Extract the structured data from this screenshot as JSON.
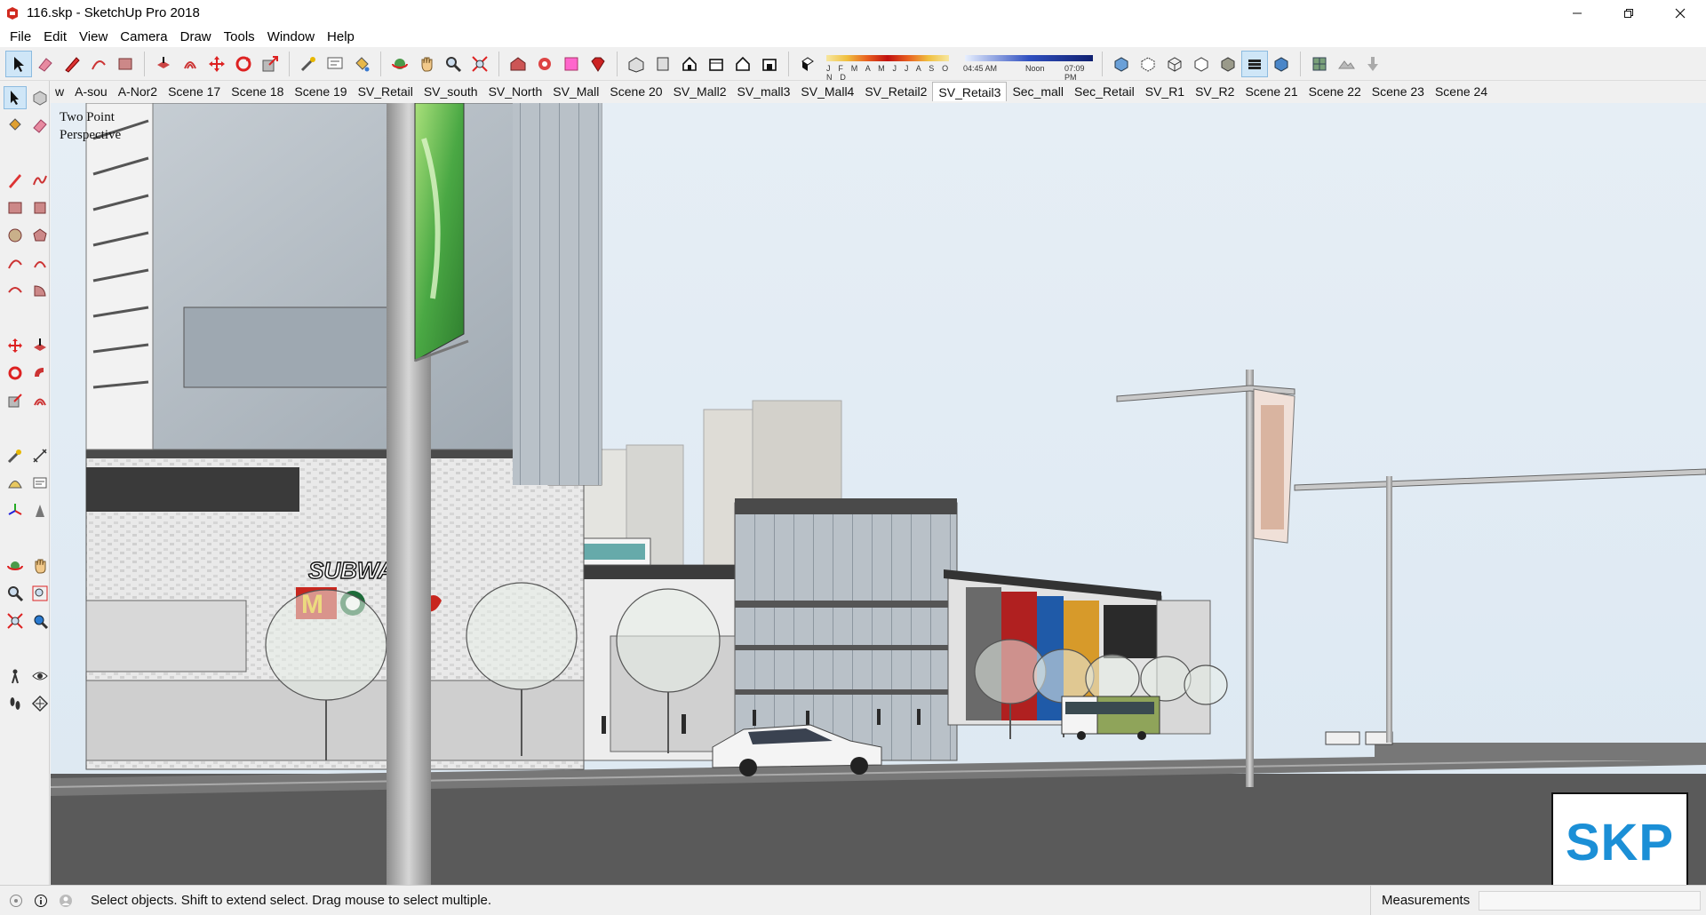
{
  "window": {
    "title": "116.skp - SketchUp Pro 2018",
    "controls": [
      "minimize",
      "restore",
      "close"
    ]
  },
  "menu": [
    "File",
    "Edit",
    "View",
    "Camera",
    "Draw",
    "Tools",
    "Window",
    "Help"
  ],
  "toolbar": {
    "months_label": "J F M A M J J A S O N D",
    "time_start": "04:45 AM",
    "time_mid": "Noon",
    "time_end": "07:09 PM"
  },
  "scenes": {
    "tabs": [
      "w",
      "A-sou",
      "A-Nor2",
      "Scene 17",
      "Scene 18",
      "Scene 19",
      "SV_Retail",
      "SV_south",
      "SV_North",
      "SV_Mall",
      "Scene 20",
      "SV_Mall2",
      "SV_mall3",
      "SV_Mall4",
      "SV_Retail2",
      "SV_Retail3",
      "Sec_mall",
      "Sec_Retail",
      "SV_R1",
      "SV_R2",
      "Scene 21",
      "Scene 22",
      "Scene 23",
      "Scene 24"
    ],
    "active": "SV_Retail3"
  },
  "viewport": {
    "perspective_line1": "Two Point",
    "perspective_line2": "Perspective",
    "logo_text": "SKP",
    "signs": {
      "subway": "SUBWAY"
    }
  },
  "status": {
    "message": "Select objects. Shift to extend select. Drag mouse to select multiple.",
    "measurements_label": "Measurements",
    "measurements_value": ""
  },
  "colors": {
    "sky": "#dfeaf3",
    "ground": "#5a5a5a",
    "logo_blue": "#1b8fd6",
    "accent_red": "#c8261e"
  }
}
